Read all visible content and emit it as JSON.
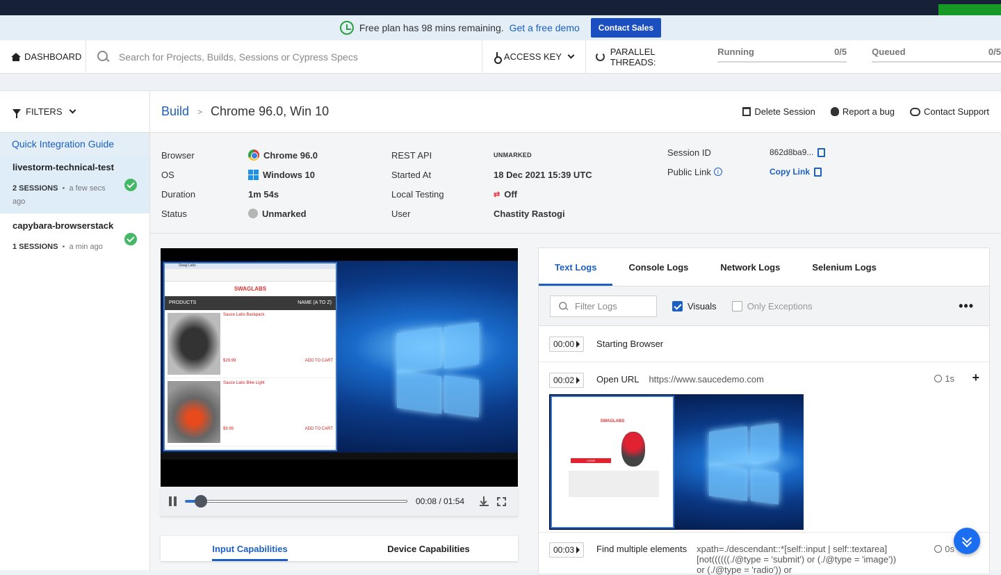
{
  "promo": {
    "text": "Free plan has 98 mins remaining.",
    "link": "Get a free demo",
    "button": "Contact Sales"
  },
  "nav": {
    "dashboard": "DASHBOARD",
    "search_placeholder": "Search for Projects, Builds, Sessions or Cypress Specs",
    "access_key": "ACCESS KEY",
    "parallel_label": "PARALLEL THREADS:",
    "running_label": "Running",
    "running_value": "0/5",
    "queued_label": "Queued",
    "queued_value": "0/5"
  },
  "sidebar": {
    "filters": "FILTERS",
    "guide": "Quick Integration Guide",
    "sessions": [
      {
        "name": "livestorm-technical-test",
        "count": "2 SESSIONS",
        "time": "a few secs ago"
      },
      {
        "name": "capybara-browserstack",
        "count": "1 SESSIONS",
        "time": "a min ago"
      }
    ]
  },
  "header": {
    "crumb": "Build",
    "title": "Chrome 96.0, Win 10",
    "delete": "Delete Session",
    "bug": "Report a bug",
    "support": "Contact Support"
  },
  "info": {
    "browser_label": "Browser",
    "browser": "Chrome 96.0",
    "os_label": "OS",
    "os": "Windows 10",
    "duration_label": "Duration",
    "duration": "1m 54s",
    "status_label": "Status",
    "status": "Unmarked",
    "rest_label": "REST API",
    "rest": "UNMARKED",
    "started_label": "Started At",
    "started": "18 Dec 2021 15:39 UTC",
    "local_label": "Local Testing",
    "local": "Off",
    "user_label": "User",
    "user": "Chastity Rastogi",
    "sid_label": "Session ID",
    "sid": "862d8ba9...",
    "public_label": "Public Link",
    "public": "Copy Link"
  },
  "player": {
    "time": "00:08 / 01:54",
    "progress": 0.07
  },
  "cap_tabs": {
    "input": "Input Capabilities",
    "device": "Device Capabilities"
  },
  "logs": {
    "tabs": [
      "Text Logs",
      "Console Logs",
      "Network Logs",
      "Selenium Logs"
    ],
    "filter_placeholder": "Filter Logs",
    "visuals": "Visuals",
    "only_exceptions": "Only Exceptions",
    "more": "•••",
    "entries": [
      {
        "time": "00:00",
        "cmd": "Starting Browser",
        "arg": ""
      },
      {
        "time": "00:02",
        "cmd": "Open URL",
        "arg": "https://www.saucedemo.com",
        "dur": "1s"
      },
      {
        "time": "00:03",
        "cmd": "Find multiple elements",
        "arg": "xpath=./descendant::*[self::input | self::textarea]",
        "arg2": "[not((((((./@type = 'submit') or (./@type = 'image')) or (./@type = 'radio')) or",
        "dur": "0s"
      }
    ]
  },
  "screen": {
    "app_title": "Swag Labs",
    "logo": "SWAGLABS",
    "products": "PRODUCTS",
    "sort": "NAME (A TO Z)",
    "item1": "Sauce Labs Backpack",
    "price1": "$29.99",
    "item2": "Sauce Labs Bike Light",
    "price2": "$9.99",
    "add": "ADD TO CART",
    "login_btn": "LOGIN"
  }
}
